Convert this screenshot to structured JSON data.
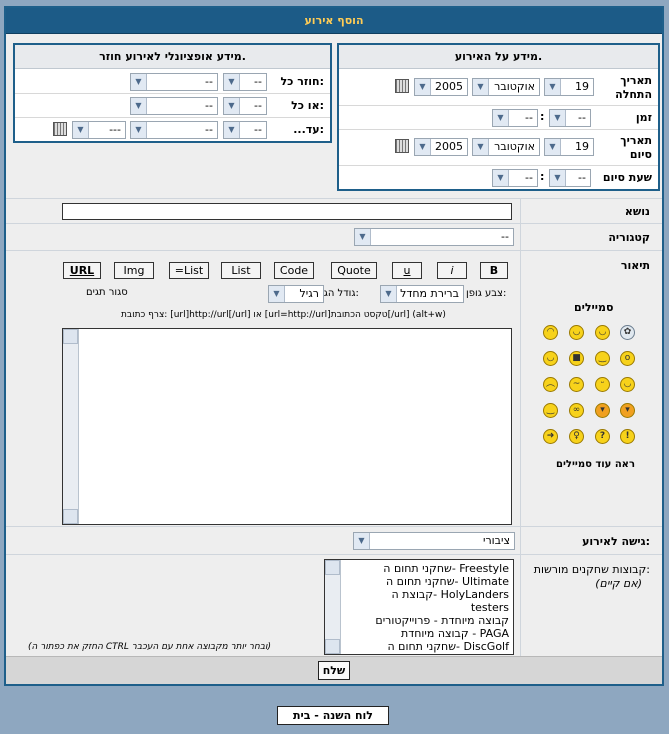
{
  "header": {
    "title": "הוסף אירוע"
  },
  "event_info": {
    "title": "מידע על האירוע.",
    "start_date_label": "תאריך התחלה",
    "time_label": "זמן",
    "end_date_label": "תאריך סיום",
    "end_time_label": "שעת סיום",
    "start_day": "19",
    "start_month": "אוקטובר",
    "start_year": "2005",
    "time_hour": "--",
    "time_min": "--",
    "end_day": "19",
    "end_month": "אוקטובר",
    "end_year": "2005",
    "end_hour": "--",
    "end_min": "--",
    "colon": ":"
  },
  "recurring": {
    "title": "מידע אופציונלי לאירוע חוזר.",
    "repeat_every_label": "חוזר כל:",
    "or_every_label": "או כל:",
    "until_label": "...עד:",
    "repeat_a": "--",
    "repeat_b": "--",
    "or_a": "--",
    "or_b": "--",
    "until_a": "--",
    "until_b": "--",
    "until_c": "---"
  },
  "form": {
    "subject_label": "נושא",
    "category_label": "קטגוריה",
    "category_value": "--",
    "description_label": "תיאור",
    "smilies_title": "סמיילים",
    "more_smilies": "ראה עוד סמיילים",
    "access_label": "גישה לאירוע:",
    "access_value": "ציבורי",
    "groups_label": "קבוצות שחקנים מורשות:",
    "groups_sub": "(אם קיים)",
    "groups_hint": "(החזק את כפתור ה CTRL ובחר יותר מקבוצה אחת עם העכבר)",
    "submit": "שלח"
  },
  "toolbar": {
    "bold": "B",
    "italic": "i",
    "underline": "u",
    "quote": "Quote",
    "code": "Code",
    "list": "List",
    "list_eq": "=List",
    "img": "Img",
    "url": "URL",
    "font_color_label": "צבע גופן:",
    "font_color_value": "ברירת מחדל",
    "font_size_label": "גודל הגופן:",
    "font_size_value": "רגיל",
    "close_tags": "סגור תגים",
    "hint": "צרף כתובת: [url]http://url[/url] או [url=http://url]טקסט הכתובת[/url]  (alt+w)"
  },
  "groups": [
    "שחקני תחום ה- Freestyle",
    "שחקני תחום ה- Ultimate",
    "קבוצת ה- HolyLanders",
    "testers",
    "קבוצה מיוחדת - פרוייקטורים",
    "קבוצה מיוחדת - PAGA",
    "שחקני תחום ה- DiscGolf"
  ],
  "footer": {
    "nav": "לוח השנה - בית"
  }
}
